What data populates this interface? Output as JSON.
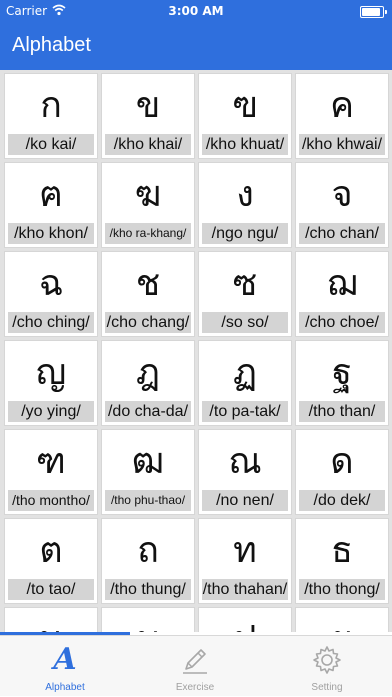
{
  "status_bar": {
    "carrier": "Carrier",
    "time": "3:00 AM"
  },
  "nav": {
    "title": "Alphabet"
  },
  "letters": [
    {
      "glyph": "ก",
      "roman": "/ko kai/"
    },
    {
      "glyph": "ข",
      "roman": "/kho khai/"
    },
    {
      "glyph": "ฃ",
      "roman": "/kho khuat/"
    },
    {
      "glyph": "ค",
      "roman": "/kho khwai/"
    },
    {
      "glyph": "ฅ",
      "roman": "/kho khon/"
    },
    {
      "glyph": "ฆ",
      "roman": "/kho ra-khang/"
    },
    {
      "glyph": "ง",
      "roman": "/ngo ngu/"
    },
    {
      "glyph": "จ",
      "roman": "/cho chan/"
    },
    {
      "glyph": "ฉ",
      "roman": "/cho ching/"
    },
    {
      "glyph": "ช",
      "roman": "/cho chang/"
    },
    {
      "glyph": "ซ",
      "roman": "/so so/"
    },
    {
      "glyph": "ฌ",
      "roman": "/cho choe/"
    },
    {
      "glyph": "ญ",
      "roman": "/yo ying/"
    },
    {
      "glyph": "ฎ",
      "roman": "/do cha-da/"
    },
    {
      "glyph": "ฏ",
      "roman": "/to pa-tak/"
    },
    {
      "glyph": "ฐ",
      "roman": "/tho than/"
    },
    {
      "glyph": "ฑ",
      "roman": "/tho montho/"
    },
    {
      "glyph": "ฒ",
      "roman": "/tho phu-thao/"
    },
    {
      "glyph": "ณ",
      "roman": "/no nen/"
    },
    {
      "glyph": "ด",
      "roman": "/do dek/"
    },
    {
      "glyph": "ต",
      "roman": "/to tao/"
    },
    {
      "glyph": "ถ",
      "roman": "/tho thung/"
    },
    {
      "glyph": "ท",
      "roman": "/tho thahan/"
    },
    {
      "glyph": "ธ",
      "roman": "/tho thong/"
    },
    {
      "glyph": "น",
      "roman": ""
    },
    {
      "glyph": "บ",
      "roman": ""
    },
    {
      "glyph": "ป",
      "roman": ""
    },
    {
      "glyph": "ผ",
      "roman": ""
    }
  ],
  "tabs": [
    {
      "label": "Alphabet",
      "icon": "alphabet-a-icon",
      "active": true
    },
    {
      "label": "Exercise",
      "icon": "pencil-icon",
      "active": false
    },
    {
      "label": "Setting",
      "icon": "gear-icon",
      "active": false
    }
  ],
  "colors": {
    "accent": "#2f6fdd",
    "label_bg": "#d4d4d4",
    "inactive": "#a0a0a0"
  }
}
